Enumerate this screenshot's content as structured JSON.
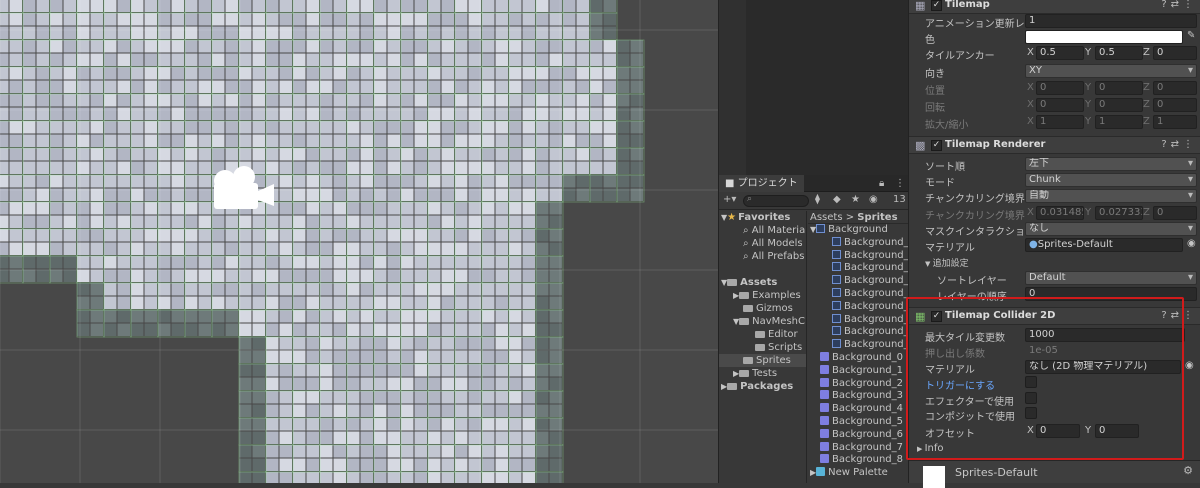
{
  "project": {
    "tab_label": "プロジェクト",
    "count_badge": "13",
    "lock_icon": "lock-icon",
    "menu_icon": "kebab-menu-icon",
    "tree": {
      "favorites": "Favorites",
      "fav_items": [
        "All Materia",
        "All Models",
        "All Prefabs"
      ],
      "assets": "Assets",
      "asset_items": [
        "Examples",
        "Gizmos",
        "NavMeshC"
      ],
      "navmesh_children": [
        "Editor",
        "Scripts"
      ],
      "sprites": "Sprites",
      "tests": "Tests",
      "packages": "Packages"
    },
    "breadcrumb": {
      "root": "Assets",
      "current": "Sprites"
    },
    "files": {
      "background": "Background",
      "bg_children": [
        "Background_0",
        "Background_1",
        "Background_2",
        "Background_3",
        "Background_4",
        "Background_5",
        "Background_6",
        "Background_7",
        "Background_8"
      ],
      "tiles": [
        "Background_0",
        "Background_1",
        "Background_2",
        "Background_3",
        "Background_4",
        "Background_5",
        "Background_6",
        "Background_7",
        "Background_8"
      ],
      "palette": "New Palette"
    }
  },
  "inspector": {
    "tilemap": {
      "title": "Tilemap",
      "anim_label": "アニメーション更新レ",
      "anim_value": "1",
      "color_label": "色",
      "anchor_label": "タイルアンカー",
      "anchor": {
        "x": "0.5",
        "y": "0.5",
        "z": "0"
      },
      "orientation_label": "向き",
      "orientation_value": "XY",
      "position_label": "位置",
      "position": {
        "x": "0",
        "y": "0",
        "z": "0"
      },
      "rotation_label": "回転",
      "rotation": {
        "x": "0",
        "y": "0",
        "z": "0"
      },
      "scale_label": "拡大/縮小",
      "scale": {
        "x": "1",
        "y": "1",
        "z": "1"
      }
    },
    "renderer": {
      "title": "Tilemap Renderer",
      "sort_label": "ソート順",
      "sort_value": "左下",
      "mode_label": "モード",
      "mode_value": "Chunk",
      "culling_label": "チャンクカリング境界",
      "culling_value": "自動",
      "culling2_label": "チャンクカリング境界",
      "culling2": {
        "x": "0.031485",
        "y": "0.027333",
        "z": "0"
      },
      "mask_label": "マスクインタラクション",
      "mask_value": "なし",
      "material_label": "マテリアル",
      "material_value": "Sprites-Default",
      "additional_label": "追加設定",
      "sort_layer_label": "ソートレイヤー",
      "sort_layer_value": "Default",
      "layer_order_label": "レイヤーの順序",
      "layer_order_value": "0"
    },
    "collider": {
      "title": "Tilemap Collider 2D",
      "max_tile_label": "最大タイル変更数",
      "max_tile_value": "1000",
      "extrusion_label": "押し出し係数",
      "extrusion_value": "1e-05",
      "material_label": "マテリアル",
      "material_value": "なし (2D 物理マテリアル)",
      "trigger_label": "トリガーにする",
      "effector_label": "エフェクターで使用",
      "composite_label": "コンポジットで使用",
      "offset_label": "オフセット",
      "offset": {
        "x": "0",
        "y": "0"
      },
      "info_label": "Info"
    },
    "footer_material": "Sprites-Default",
    "axis": {
      "x": "X",
      "y": "Y",
      "z": "Z"
    }
  },
  "colors": {
    "highlight_box": "#d11b1b",
    "link_blue": "#6aa7ff",
    "scene_bg": "#484848"
  }
}
